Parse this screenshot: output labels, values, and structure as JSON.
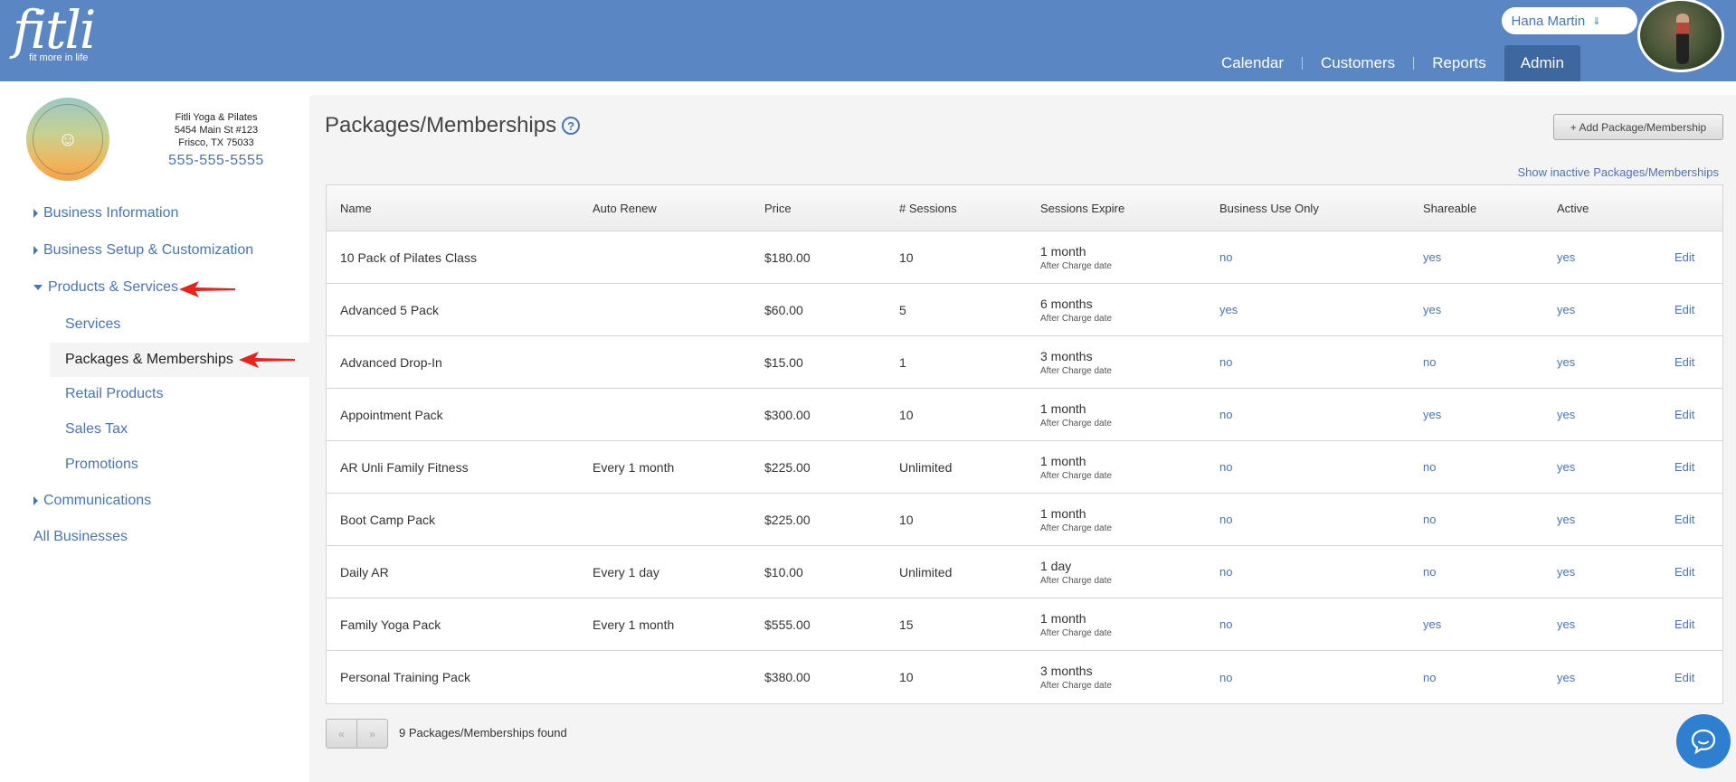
{
  "brand": {
    "name": "fitli",
    "tagline": "fit more in life"
  },
  "user": {
    "name": "Hana Martin"
  },
  "nav": [
    {
      "label": "Calendar"
    },
    {
      "label": "Customers"
    },
    {
      "label": "Reports"
    },
    {
      "label": "Admin",
      "active": true
    }
  ],
  "business": {
    "name": "Fitli Yoga & Pilates",
    "address1": "5454 Main St #123",
    "address2": "Frisco, TX 75033",
    "phone": "555-555-5555"
  },
  "sidebar": {
    "business_information": "Business Information",
    "business_setup": "Business Setup & Customization",
    "products_services": "Products & Services",
    "sub": {
      "services": "Services",
      "packages": "Packages & Memberships",
      "retail": "Retail Products",
      "sales_tax": "Sales Tax",
      "promotions": "Promotions"
    },
    "communications": "Communications",
    "all_businesses": "All Businesses"
  },
  "main": {
    "title": "Packages/Memberships",
    "help_icon": "?",
    "add_button": "+ Add Package/Membership",
    "show_inactive": "Show inactive Packages/Memberships",
    "columns": {
      "name": "Name",
      "auto_renew": "Auto Renew",
      "price": "Price",
      "sessions": "# Sessions",
      "expire": "Sessions Expire",
      "business_only": "Business Use Only",
      "shareable": "Shareable",
      "active": "Active"
    },
    "rows": [
      {
        "name": "10 Pack of Pilates Class",
        "auto_renew": "",
        "price": "$180.00",
        "sessions": "10",
        "expire": "1 month",
        "expire_sub": "After Charge date",
        "business_only": "no",
        "shareable": "yes",
        "active": "yes",
        "edit": "Edit"
      },
      {
        "name": "Advanced 5 Pack",
        "auto_renew": "",
        "price": "$60.00",
        "sessions": "5",
        "expire": "6 months",
        "expire_sub": "After Charge date",
        "business_only": "yes",
        "shareable": "yes",
        "active": "yes",
        "edit": "Edit"
      },
      {
        "name": "Advanced Drop-In",
        "auto_renew": "",
        "price": "$15.00",
        "sessions": "1",
        "expire": "3 months",
        "expire_sub": "After Charge date",
        "business_only": "no",
        "shareable": "no",
        "active": "yes",
        "edit": "Edit"
      },
      {
        "name": "Appointment Pack",
        "auto_renew": "",
        "price": "$300.00",
        "sessions": "10",
        "expire": "1 month",
        "expire_sub": "After Charge date",
        "business_only": "no",
        "shareable": "yes",
        "active": "yes",
        "edit": "Edit"
      },
      {
        "name": "AR Unli Family Fitness",
        "auto_renew": "Every 1 month",
        "price": "$225.00",
        "sessions": "Unlimited",
        "expire": "1 month",
        "expire_sub": "After Charge date",
        "business_only": "no",
        "shareable": "no",
        "active": "yes",
        "edit": "Edit"
      },
      {
        "name": "Boot Camp Pack",
        "auto_renew": "",
        "price": "$225.00",
        "sessions": "10",
        "expire": "1 month",
        "expire_sub": "After Charge date",
        "business_only": "no",
        "shareable": "no",
        "active": "yes",
        "edit": "Edit"
      },
      {
        "name": "Daily AR",
        "auto_renew": "Every 1 day",
        "price": "$10.00",
        "sessions": "Unlimited",
        "expire": "1 day",
        "expire_sub": "After Charge date",
        "business_only": "no",
        "shareable": "no",
        "active": "yes",
        "edit": "Edit"
      },
      {
        "name": "Family Yoga Pack",
        "auto_renew": "Every 1 month",
        "price": "$555.00",
        "sessions": "15",
        "expire": "1 month",
        "expire_sub": "After Charge date",
        "business_only": "no",
        "shareable": "yes",
        "active": "yes",
        "edit": "Edit"
      },
      {
        "name": "Personal Training Pack",
        "auto_renew": "",
        "price": "$380.00",
        "sessions": "10",
        "expire": "3 months",
        "expire_sub": "After Charge date",
        "business_only": "no",
        "shareable": "no",
        "active": "yes",
        "edit": "Edit"
      }
    ],
    "pager": {
      "prev": "«",
      "next": "»"
    },
    "found_text": "9 Packages/Memberships found"
  },
  "colors": {
    "header": "#5b86c4",
    "link": "#4a74b8",
    "nav_active": "#3e679f",
    "chat": "#2f7fd1",
    "annotation_arrow": "#e8231c"
  },
  "icons": {
    "help": "question-circle-icon",
    "chat": "chat-bubble-icon",
    "user_menu": "chevron-down-icon"
  }
}
